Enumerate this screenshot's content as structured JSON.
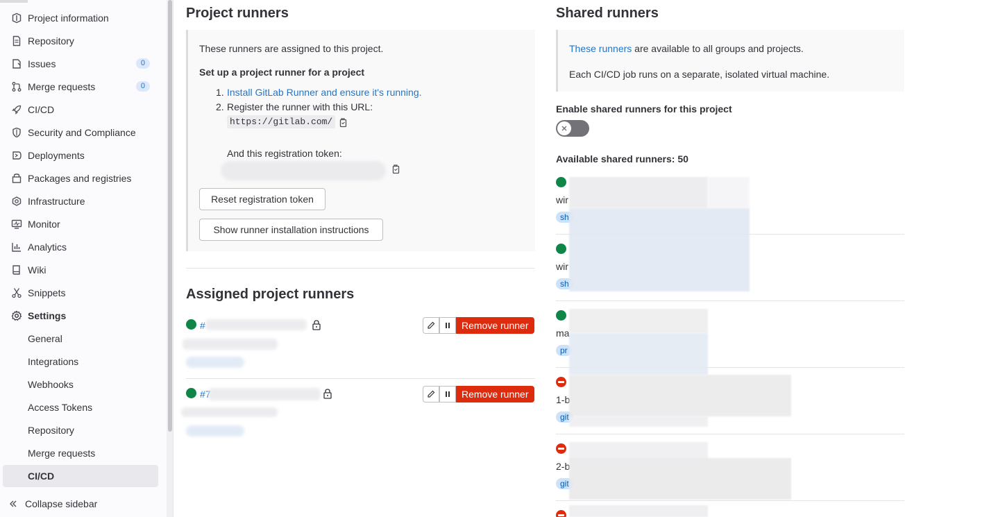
{
  "sidebar": {
    "items": [
      {
        "label": "Project information",
        "icon": "project-icon"
      },
      {
        "label": "Repository",
        "icon": "doc-icon"
      },
      {
        "label": "Issues",
        "icon": "issues-icon",
        "count": "0"
      },
      {
        "label": "Merge requests",
        "icon": "merge-request-icon",
        "count": "0"
      },
      {
        "label": "CI/CD",
        "icon": "rocket-icon"
      },
      {
        "label": "Security and Compliance",
        "icon": "shield-icon"
      },
      {
        "label": "Deployments",
        "icon": "deployments-icon"
      },
      {
        "label": "Packages and registries",
        "icon": "package-icon"
      },
      {
        "label": "Infrastructure",
        "icon": "cloud-gear-icon"
      },
      {
        "label": "Monitor",
        "icon": "monitor-icon"
      },
      {
        "label": "Analytics",
        "icon": "chart-icon"
      },
      {
        "label": "Wiki",
        "icon": "book-icon"
      },
      {
        "label": "Snippets",
        "icon": "scissors-icon"
      },
      {
        "label": "Settings",
        "icon": "settings-icon"
      }
    ],
    "settings_sub": [
      "General",
      "Integrations",
      "Webhooks",
      "Access Tokens",
      "Repository",
      "Merge requests",
      "CI/CD"
    ],
    "active": "CI/CD",
    "collapse_label": "Collapse sidebar"
  },
  "project_runners": {
    "title": "Project runners",
    "intro": "These runners are assigned to this project.",
    "setup_heading": "Set up a project runner for a project",
    "step1_num": "1.",
    "step1_link": "Install GitLab Runner and ensure it's running.",
    "step2_num": "2.",
    "step2_text": "Register the runner with this URL:",
    "url": "https://gitlab.com/",
    "token_label": "And this registration token:",
    "reset_button": "Reset registration token",
    "instructions_button": "Show runner installation instructions"
  },
  "assigned": {
    "title": "Assigned project runners",
    "runners": [
      {
        "id_prefix": "#",
        "remove_label": "Remove runner"
      },
      {
        "id_prefix": "#7",
        "remove_label": "Remove runner"
      }
    ]
  },
  "shared": {
    "title": "Shared runners",
    "link": "These runners",
    "intro_rest": " are available to all groups and projects.",
    "vm_note": "Each CI/CD job runs on a separate, isolated virtual machine.",
    "enable_label": "Enable shared runners for this project",
    "available": "Available shared runners: 50",
    "runners": [
      {
        "status": "online",
        "name": "wir",
        "tag": "sh"
      },
      {
        "status": "online",
        "name": "wir",
        "tag": "sh"
      },
      {
        "status": "online",
        "name": "ma",
        "tag": "pr"
      },
      {
        "status": "paused",
        "name": "1-b",
        "tag": "git"
      },
      {
        "status": "paused",
        "name": "2-b",
        "tag": "git"
      },
      {
        "status": "paused",
        "name": "",
        "tag": ""
      }
    ]
  },
  "colors": {
    "accent": "#1f75cb",
    "danger": "#dd2b0e",
    "success": "#108548"
  }
}
